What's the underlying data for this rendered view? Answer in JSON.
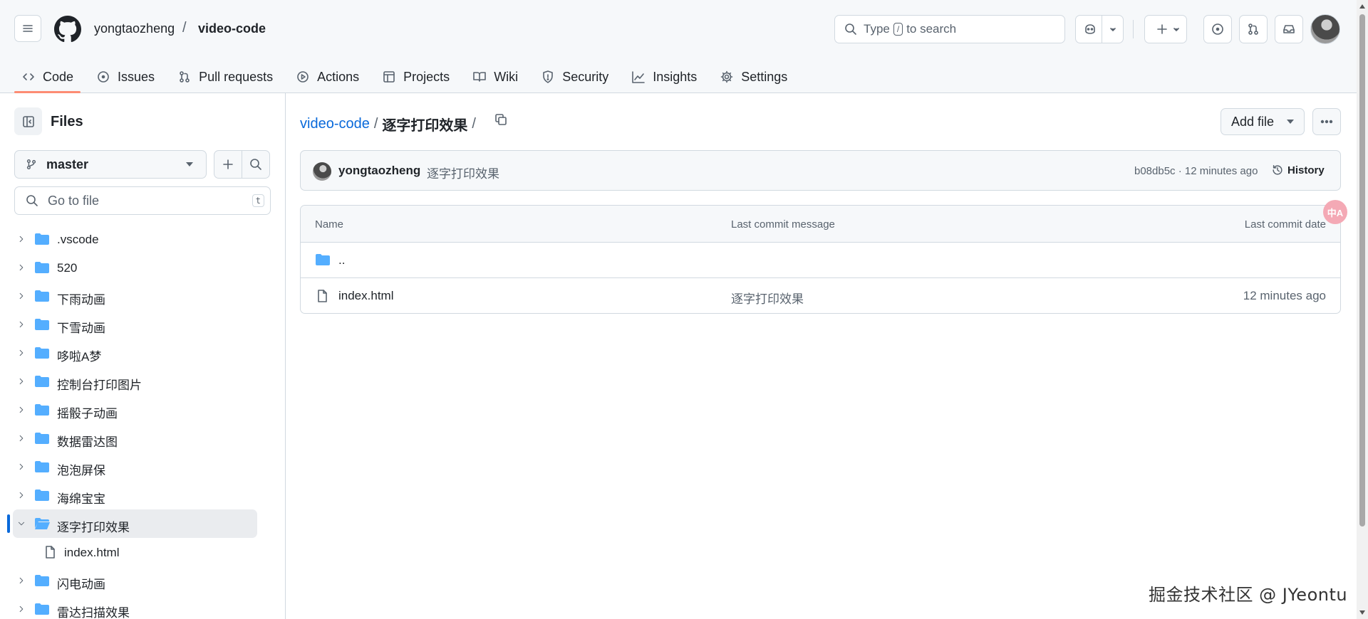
{
  "header": {
    "owner": "yongtaozheng",
    "separator": "/",
    "repo": "video-code",
    "search": {
      "prefix": "Type",
      "key": "/",
      "suffix": "to search"
    },
    "avatar_icon": "user-avatar"
  },
  "tabs": [
    {
      "label": "Code",
      "icon": "code-icon",
      "active": true
    },
    {
      "label": "Issues",
      "icon": "issue-icon"
    },
    {
      "label": "Pull requests",
      "icon": "pull-request-icon"
    },
    {
      "label": "Actions",
      "icon": "play-icon"
    },
    {
      "label": "Projects",
      "icon": "table-icon"
    },
    {
      "label": "Wiki",
      "icon": "book-icon"
    },
    {
      "label": "Security",
      "icon": "shield-icon"
    },
    {
      "label": "Insights",
      "icon": "graph-icon"
    },
    {
      "label": "Settings",
      "icon": "gear-icon"
    }
  ],
  "sidebar": {
    "title": "Files",
    "branch": "master",
    "goto_placeholder": "Go to file",
    "goto_key": "t",
    "tree": [
      {
        "name": ".vscode",
        "type": "folder"
      },
      {
        "name": "520",
        "type": "folder"
      },
      {
        "name": "下雨动画",
        "type": "folder"
      },
      {
        "name": "下雪动画",
        "type": "folder"
      },
      {
        "name": "哆啦A梦",
        "type": "folder"
      },
      {
        "name": "控制台打印图片",
        "type": "folder"
      },
      {
        "name": "摇骰子动画",
        "type": "folder"
      },
      {
        "name": "数据雷达图",
        "type": "folder"
      },
      {
        "name": "泡泡屏保",
        "type": "folder"
      },
      {
        "name": "海绵宝宝",
        "type": "folder"
      },
      {
        "name": "逐字打印效果",
        "type": "folder",
        "open": true,
        "active": true
      },
      {
        "name": "index.html",
        "type": "file",
        "child": true
      },
      {
        "name": "闪电动画",
        "type": "folder"
      },
      {
        "name": "雷达扫描效果",
        "type": "folder"
      }
    ]
  },
  "breadcrumb": {
    "repo": "video-code",
    "sep": "/",
    "current": "逐字打印效果",
    "trail": "/"
  },
  "actions": {
    "add_file": "Add file"
  },
  "commit": {
    "author": "yongtaozheng",
    "message": "逐字打印效果",
    "meta": "b08db5c · 12 minutes ago",
    "history": "History"
  },
  "table": {
    "headers": {
      "name": "Name",
      "message": "Last commit message",
      "date": "Last commit date"
    },
    "rows": [
      {
        "name": "..",
        "type": "folder",
        "message": "",
        "date": ""
      },
      {
        "name": "index.html",
        "type": "file",
        "message": "逐字打印效果",
        "date": "12 minutes ago"
      }
    ]
  },
  "badge": "中A",
  "watermark": "掘金技术社区 @ JYeontu",
  "colors": {
    "accent": "#0969da",
    "tab_underline": "#fd8c73",
    "folder": "#54aeff"
  }
}
